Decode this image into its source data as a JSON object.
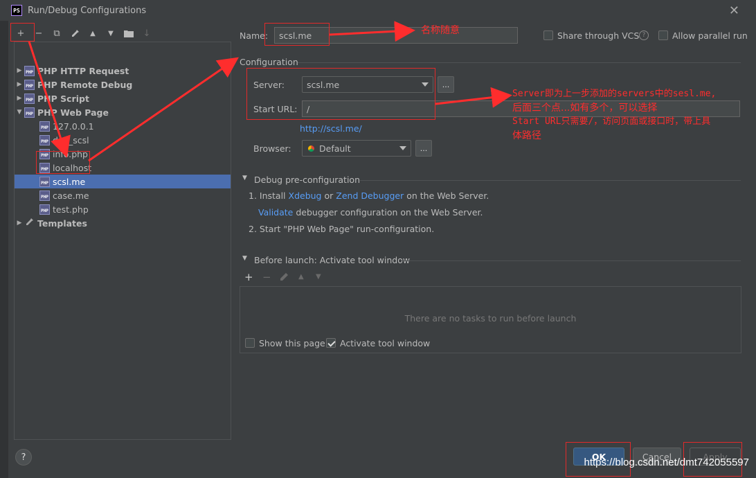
{
  "window": {
    "title": "Run/Debug Configurations",
    "icon_text": "PS"
  },
  "toolbar": {
    "add": "+",
    "remove": "−",
    "copy": "⧉",
    "edit": "🔧",
    "up": "▲",
    "down": "▼",
    "folder": "📁",
    "sort": "↓"
  },
  "tree": {
    "items": [
      {
        "label": "PHP HTTP Request",
        "expanded": false
      },
      {
        "label": "PHP Remote Debug",
        "expanded": false
      },
      {
        "label": "PHP Script",
        "expanded": false
      },
      {
        "label": "PHP Web Page",
        "expanded": true
      }
    ],
    "children": [
      "127.0.0.1",
      "dev_scsl",
      "info.php",
      "localhost",
      "scsl.me",
      "case.me",
      "test.php"
    ],
    "selected_child": "scsl.me",
    "templates": "Templates"
  },
  "form": {
    "name_label": "Name:",
    "name_value": "scsl.me",
    "share_label": "Share through VCS",
    "parallel_label": "Allow parallel run",
    "configuration_heading": "Configuration",
    "server_label": "Server:",
    "server_value": "scsl.me",
    "start_url_label": "Start URL:",
    "start_url_value": "/",
    "url_hint": "http://scsl.me/",
    "browser_label": "Browser:",
    "browser_value": "Default",
    "dots": "..."
  },
  "debug_preconfig": {
    "heading": "Debug pre-configuration",
    "step1_prefix": "1. Install",
    "xdebug": "Xdebug",
    "or": "or",
    "zend": "Zend Debugger",
    "step1_suffix": "on the Web Server.",
    "validate": "Validate",
    "validate_suffix": "debugger configuration on the Web Server.",
    "step2": "2. Start \"PHP Web Page\" run-configuration."
  },
  "before_launch": {
    "heading": "Before launch: Activate tool window",
    "empty_text": "There are no tasks to run before launch",
    "show_page": "Show this page",
    "activate_tool": "Activate tool window"
  },
  "buttons": {
    "ok": "OK",
    "cancel": "Cancel",
    "apply": "Apply",
    "help": "?"
  },
  "annotations": {
    "name_note": "名称随意",
    "server_note_line1": "Server即为上一步添加的servers中的sesl.me,",
    "server_note_line2": "后面三个点...如有多个，可以选择",
    "server_note_line3": "Start URL只需要/，访问页面或接口时，带上具",
    "server_note_line4": "体路径"
  },
  "watermark": "https://blog.csdn.net/dmt742055597"
}
